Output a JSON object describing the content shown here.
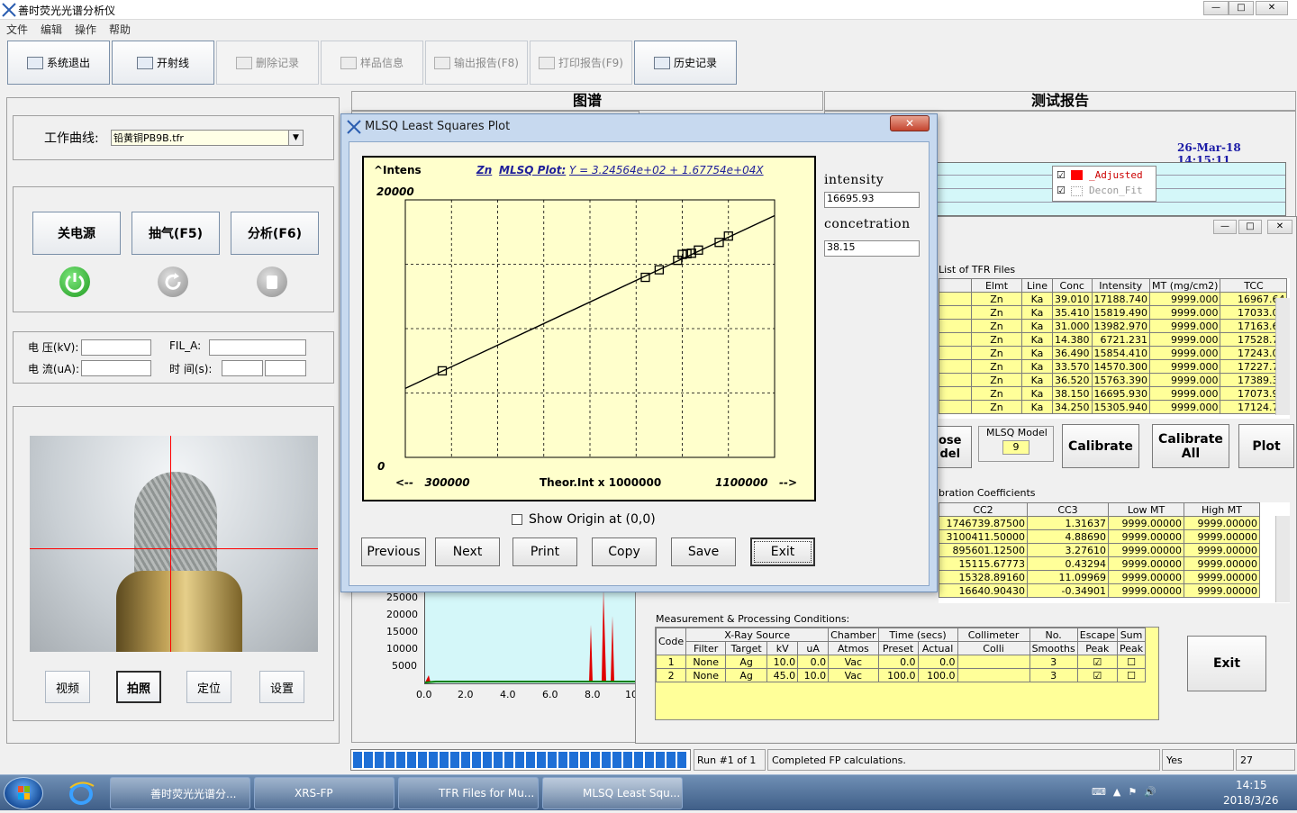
{
  "window": {
    "title": "善时荧光光谱分析仪"
  },
  "menu": [
    "文件",
    "编辑",
    "操作",
    "帮助"
  ],
  "toolbar": [
    {
      "label": "系统退出",
      "icon": "exit-icon"
    },
    {
      "label": "开射线",
      "icon": "xray-icon"
    },
    {
      "label": "删除记录",
      "icon": "delete-icon"
    },
    {
      "label": "样品信息",
      "icon": "sample-info-icon"
    },
    {
      "label": "输出报告(F8)",
      "icon": "export-icon"
    },
    {
      "label": "打印报告(F9)",
      "icon": "print-icon"
    },
    {
      "label": "历史记录",
      "icon": "history-icon"
    }
  ],
  "left": {
    "curve_label": "工作曲线:",
    "curve_value": "铅黄铜PB9B.tfr",
    "btn_power": "关电源",
    "btn_pump": "抽气(F5)",
    "btn_analyze": "分析(F6)",
    "voltage_label": "电  压(kV):",
    "current_label": "电  流(uA):",
    "fil_label": "FIL_A:",
    "time_label": "时  间(s):",
    "cam_buttons": [
      "视频",
      "拍照",
      "定位",
      "设置"
    ]
  },
  "tabs": {
    "spectrum": "图谱",
    "report": "测试报告"
  },
  "report": {
    "datetime": "26-Mar-18  14:15:11",
    "legend": [
      "_Adjusted",
      "Decon_Fit"
    ]
  },
  "spectrum": {
    "y_ticks": [
      "25000",
      "20000",
      "15000",
      "10000",
      "5000"
    ],
    "x_ticks": [
      "0.0",
      "2.0",
      "4.0",
      "6.0",
      "8.0",
      "10"
    ]
  },
  "tfr": {
    "title": "List of TFR Files",
    "headers": [
      "Elmt",
      "Line",
      "Conc",
      "Intensity",
      "MT (mg/cm2)",
      "TCC"
    ],
    "rows": [
      [
        "Zn",
        "Ka",
        "39.010",
        "17188.740",
        "9999.000",
        "16967.64"
      ],
      [
        "Zn",
        "Ka",
        "35.410",
        "15819.490",
        "9999.000",
        "17033.08"
      ],
      [
        "Zn",
        "Ka",
        "31.000",
        "13982.970",
        "9999.000",
        "17163.60"
      ],
      [
        "Zn",
        "Ka",
        "14.380",
        "6721.231",
        "9999.000",
        "17528.77"
      ],
      [
        "Zn",
        "Ka",
        "36.490",
        "15854.410",
        "9999.000",
        "17243.00"
      ],
      [
        "Zn",
        "Ka",
        "33.570",
        "14570.300",
        "9999.000",
        "17227.76"
      ],
      [
        "Zn",
        "Ka",
        "36.520",
        "15763.390",
        "9999.000",
        "17389.33"
      ],
      [
        "Zn",
        "Ka",
        "38.150",
        "16695.930",
        "9999.000",
        "17073.91"
      ],
      [
        "Zn",
        "Ka",
        "34.250",
        "15305.940",
        "9999.000",
        "17124.79"
      ]
    ]
  },
  "mlsq_model": {
    "label": "MLSQ Model",
    "value": "9"
  },
  "actions": {
    "close_model": "ose\ndel",
    "calibrate": "Calibrate",
    "calibrate_all": "Calibrate\nAll",
    "plot": "Plot"
  },
  "coeffs": {
    "title": "bration Coefficients",
    "headers": [
      "CC2",
      "CC3",
      "Low MT",
      "High MT"
    ],
    "rows": [
      [
        "1746739.87500",
        "1.31637",
        "9999.00000",
        "9999.00000"
      ],
      [
        "3100411.50000",
        "4.88690",
        "9999.00000",
        "9999.00000"
      ],
      [
        "895601.12500",
        "3.27610",
        "9999.00000",
        "9999.00000"
      ],
      [
        "15115.67773",
        "0.43294",
        "9999.00000",
        "9999.00000"
      ],
      [
        "15328.89160",
        "11.09969",
        "9999.00000",
        "9999.00000"
      ],
      [
        "16640.90430",
        "-0.34901",
        "9999.00000",
        "9999.00000"
      ]
    ]
  },
  "conditions": {
    "title": "Measurement & Processing Conditions:",
    "groups": [
      "X-Ray Source",
      "Chamber",
      "Time (secs)",
      "Collimeter",
      "No.",
      "Escape",
      "Sum"
    ],
    "headers": [
      "Code",
      "Filter",
      "Target",
      "kV",
      "uA",
      "Atmos",
      "Preset",
      "Actual",
      "Colli",
      "Smooths",
      "Peak",
      "Peak"
    ],
    "rows": [
      [
        "1",
        "None",
        "Ag",
        "10.0",
        "0.0",
        "Vac",
        "0.0",
        "0.0",
        "",
        "3"
      ],
      [
        "2",
        "None",
        "Ag",
        "45.0",
        "10.0",
        "Vac",
        "100.0",
        "100.0",
        "",
        "3"
      ]
    ],
    "exit": "Exit"
  },
  "status": {
    "run": "Run #1 of 1",
    "message": "Completed FP calculations.",
    "yes": "Yes",
    "num": "27",
    "progress": 1.0
  },
  "dialog": {
    "title": "MLSQ Least Squares Plot",
    "element": "Zn",
    "plot_title": "MLSQ Plot:",
    "equation": "Y = 3.24564e+02 + 1.67754e+04X",
    "y_label": "^Intens",
    "y_max": "20000",
    "y_min": "0",
    "x_left": "<--   300000",
    "x_label": "Theor.Int x 1000000",
    "x_right": "1100000   -->",
    "intensity_label": "intensity",
    "intensity_value": "16695.93",
    "conc_label": "concetration",
    "conc_value": "38.15",
    "show_origin": "Show Origin at (0,0)",
    "buttons": [
      "Previous",
      "Next",
      "Print",
      "Copy",
      "Save",
      "Exit"
    ]
  },
  "chart_data": {
    "type": "scatter",
    "title": "MLSQ Plot:",
    "equation": "Y = 3.24564e+02 + 1.67754e+04X",
    "xlabel": "Theor.Int x 1000000",
    "ylabel": "^Intens",
    "xlim": [
      0.3,
      1.1
    ],
    "ylim": [
      0,
      20000
    ],
    "points": [
      {
        "x": 0.38,
        "y": 6721
      },
      {
        "x": 0.82,
        "y": 13983
      },
      {
        "x": 0.85,
        "y": 14570
      },
      {
        "x": 0.89,
        "y": 15306
      },
      {
        "x": 0.9,
        "y": 15763
      },
      {
        "x": 0.91,
        "y": 15819
      },
      {
        "x": 0.92,
        "y": 15854
      },
      {
        "x": 0.935,
        "y": 16100
      },
      {
        "x": 0.98,
        "y": 16696
      },
      {
        "x": 1.0,
        "y": 17189
      }
    ],
    "fit": {
      "intercept": 324.564,
      "slope": 16775.4
    }
  },
  "taskbar": {
    "items": [
      "善时荧光光谱分...",
      "XRS-FP",
      "TFR Files for Mu...",
      "MLSQ Least Squ..."
    ],
    "time": "14:15",
    "date": "2018/3/26"
  }
}
